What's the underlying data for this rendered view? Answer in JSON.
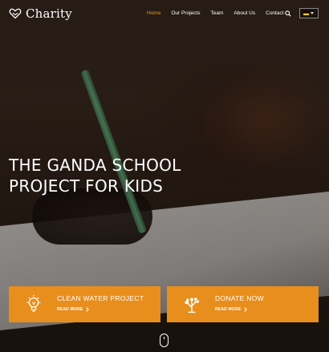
{
  "brand": {
    "name": "Charity",
    "logo_icon": "heart-hands-icon"
  },
  "nav": {
    "items": [
      {
        "label": "Home",
        "active": true
      },
      {
        "label": "Our Projects",
        "active": false
      },
      {
        "label": "Team",
        "active": false
      },
      {
        "label": "About Us",
        "active": false
      },
      {
        "label": "Contact",
        "active": false
      }
    ],
    "search_icon": "search-icon",
    "language": {
      "flag": "germany-flag-icon"
    }
  },
  "hero": {
    "headline_line1": "THE GANDA SCHOOL",
    "headline_line2": "PROJECT FOR KIDS"
  },
  "cards": [
    {
      "title": "CLEAN WATER PROJECT",
      "link": "READ MORE",
      "icon": "lightbulb-icon"
    },
    {
      "title": "DONATE NOW",
      "link": "READ MORE",
      "icon": "tree-icon"
    }
  ],
  "colors": {
    "accent": "#e88e1d",
    "nav_active": "#e39525",
    "text": "#ffffff"
  }
}
